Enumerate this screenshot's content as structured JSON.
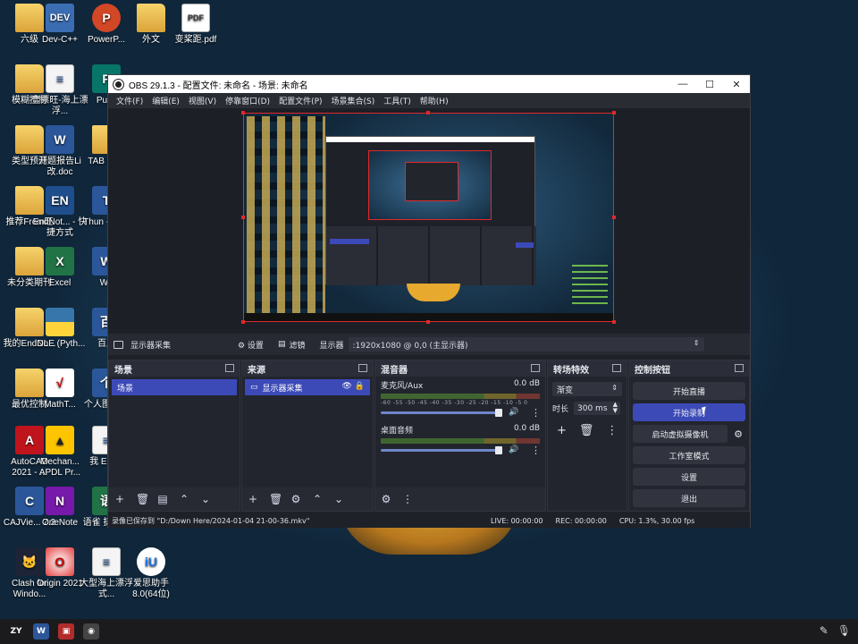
{
  "desktop": {
    "icons": [
      {
        "label": "六级",
        "kind": "folder",
        "glyph": ""
      },
      {
        "label": "Dev-C++",
        "kind": "dev",
        "glyph": "DEV"
      },
      {
        "label": "PowerP...",
        "kind": "ppt",
        "glyph": "P"
      },
      {
        "label": "外文",
        "kind": "folder",
        "glyph": ""
      },
      {
        "label": "变桨距.pdf",
        "kind": "pdf",
        "glyph": "PDF"
      },
      {
        "label": "模糊控制",
        "kind": "folder",
        "glyph": ""
      },
      {
        "label": "壹票旺-海上漂浮...",
        "kind": "doc",
        "glyph": "≡"
      },
      {
        "label": "Publi",
        "kind": "pub",
        "glyph": "P"
      },
      {
        "label": "类型预测",
        "kind": "folder",
        "glyph": ""
      },
      {
        "label": "开题报告Li改.doc",
        "kind": "word",
        "glyph": "W"
      },
      {
        "label": "TAB 捷方",
        "kind": "folder",
        "glyph": ""
      },
      {
        "label": "推荐From旺",
        "kind": "folder",
        "glyph": ""
      },
      {
        "label": "EndNot... - 快捷方式",
        "kind": "en",
        "glyph": "EN"
      },
      {
        "label": "Thun - 快捷",
        "kind": "word",
        "glyph": "T"
      },
      {
        "label": "未分类期刊",
        "kind": "folder",
        "glyph": ""
      },
      {
        "label": "Excel",
        "kind": "excel",
        "glyph": "X"
      },
      {
        "label": "Wo",
        "kind": "word",
        "glyph": "W"
      },
      {
        "label": "我的EndNo...",
        "kind": "folder",
        "glyph": ""
      },
      {
        "label": "IDLE (Pyth...",
        "kind": "py",
        "glyph": ""
      },
      {
        "label": "百度",
        "kind": "word",
        "glyph": "百"
      },
      {
        "label": "最优控制",
        "kind": "folder",
        "glyph": ""
      },
      {
        "label": "MathT...",
        "kind": "math",
        "glyph": "√"
      },
      {
        "label": "个人图书馆",
        "kind": "word",
        "glyph": "个"
      },
      {
        "label": "AutoCAD 2021 - ...",
        "kind": "cad",
        "glyph": "A"
      },
      {
        "label": "Mechan... APDL Pr...",
        "kind": "mech",
        "glyph": "▲"
      },
      {
        "label": "我 EndN",
        "kind": "doc",
        "glyph": "≡"
      },
      {
        "label": "CAJVie... 7.2",
        "kind": "word",
        "glyph": "C"
      },
      {
        "label": "OneNote",
        "kind": "one",
        "glyph": "N"
      },
      {
        "label": "语雀 捷方式",
        "kind": "excel",
        "glyph": "语"
      },
      {
        "label": "Clash for Windo...",
        "kind": "clash",
        "glyph": "🐱"
      },
      {
        "label": "Origin 2021",
        "kind": "origin",
        "glyph": "O"
      },
      {
        "label": "大型海上漂浮式...",
        "kind": "doc",
        "glyph": "≡"
      },
      {
        "label": "爱思助手8.0(64位)",
        "kind": "ai",
        "glyph": "iU"
      }
    ]
  },
  "taskbar": {
    "items": [
      {
        "name": "zy-app-icon",
        "glyph": "ZY",
        "color": "#1b1b1d"
      },
      {
        "name": "word-taskbar-icon",
        "glyph": "W",
        "color": "#2b579a"
      },
      {
        "name": "pdf-taskbar-icon",
        "glyph": "▣",
        "color": "#b32c2c"
      },
      {
        "name": "obs-taskbar-icon",
        "glyph": "◉",
        "color": "#444"
      }
    ]
  },
  "obs": {
    "title": "OBS 29.1.3 - 配置文件: 未命名 - 场景: 未命名",
    "window_controls": {
      "minimize": "—",
      "maximize": "☐",
      "close": "✕"
    },
    "menu": [
      "文件(F)",
      "编辑(E)",
      "视图(V)",
      "停靠窗口(D)",
      "配置文件(P)",
      "场景集合(S)",
      "工具(T)",
      "帮助(H)"
    ],
    "source_toolbar": {
      "source_name": "显示器采集",
      "settings_label": "⚙ 设置",
      "filters_label": "滤镜",
      "display_label": "显示器",
      "display_value": ":1920x1080 @ 0,0 (主显示器)"
    },
    "docks": {
      "scenes": {
        "title": "场景",
        "items": [
          "场景"
        ]
      },
      "sources": {
        "title": "来源",
        "items": [
          "显示器采集"
        ]
      },
      "mixer": {
        "title": "混音器",
        "channels": [
          {
            "name": "麦克风/Aux",
            "level": "0.0 dB"
          },
          {
            "name": "桌面音频",
            "level": "0.0 dB"
          }
        ],
        "ticks": "-60 -55 -50 -45 -40 -35 -30 -25 -20 -15 -10 -5 0"
      },
      "transitions": {
        "title": "转场特效",
        "type": "渐变",
        "duration_label": "时长",
        "duration_value": "300 ms"
      },
      "controls": {
        "title": "控制按钮",
        "buttons": [
          "开始直播",
          "开始录制",
          "启动虚拟摄像机",
          "工作室模式",
          "设置",
          "退出"
        ]
      }
    },
    "status": {
      "recording_path": "录像已保存到 \"D:/Down Here/2024-01-04 21-00-36.mkv\"",
      "live": "LIVE: 00:00:00",
      "rec": "REC: 00:00:00",
      "cpu": "CPU: 1.3%, 30.00 fps"
    },
    "colors": {
      "accent": "#3c4ab8",
      "preview_border": "#e0292b"
    }
  }
}
